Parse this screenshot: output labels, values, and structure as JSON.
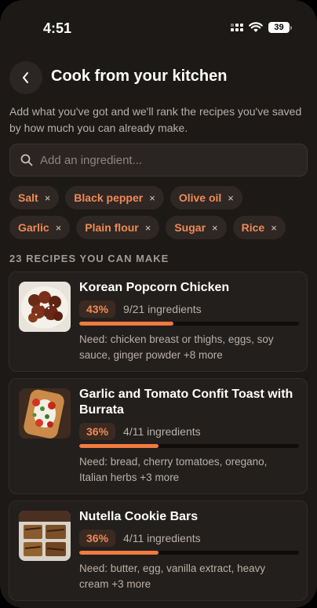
{
  "status_bar": {
    "time": "4:51",
    "battery": "39"
  },
  "header": {
    "title": "Cook from your kitchen"
  },
  "subtitle": "Add what you've got and we'll rank the recipes you've saved by how much you can already make.",
  "search": {
    "placeholder": "Add an ingredient..."
  },
  "ingredients": [
    [
      "Salt",
      "Black pepper",
      "Olive oil"
    ],
    [
      "Garlic",
      "Plain flour",
      "Sugar",
      "Rice"
    ]
  ],
  "chip_remove_glyph": "×",
  "section_label": "23 RECIPES YOU CAN MAKE",
  "recipes": [
    {
      "title": "Korean Popcorn Chicken",
      "percent": "43%",
      "match_fraction": 0.43,
      "ingredients_count": "9/21 ingredients",
      "need": "Need: chicken breast or thighs, eggs, soy sauce, ginger powder +8 more"
    },
    {
      "title": "Garlic and Tomato Confit Toast with Burrata",
      "percent": "36%",
      "match_fraction": 0.36,
      "ingredients_count": "4/11 ingredients",
      "need": "Need: bread, cherry tomatoes, oregano, Italian herbs +3 more"
    },
    {
      "title": "Nutella Cookie Bars",
      "percent": "36%",
      "match_fraction": 0.36,
      "ingredients_count": "4/11 ingredients",
      "need": "Need: butter, egg, vanilla extract, heavy cream +3 more"
    }
  ],
  "colors": {
    "accent": "#f08a55",
    "background": "#1c1917",
    "card": "#231f1c"
  }
}
